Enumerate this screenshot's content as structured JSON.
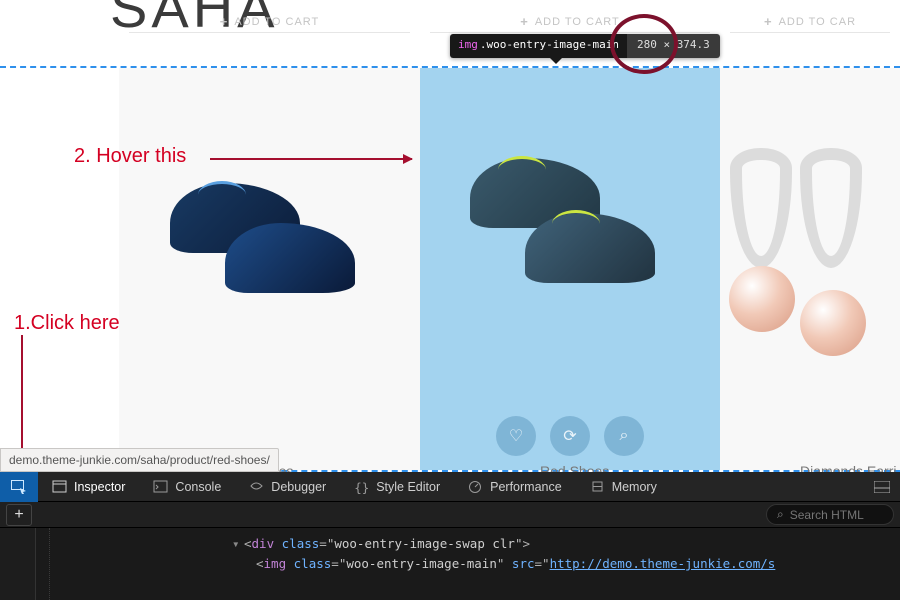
{
  "logo": "SAHA",
  "cards": {
    "c1": {
      "add": "ADD TO CART"
    },
    "c2": {
      "add": "ADD TO CART"
    },
    "c3": {
      "add": "ADD TO CAR"
    }
  },
  "productNames": {
    "p1": "hoes",
    "p2": "Red Shoes",
    "p3": "Diamonds Earri"
  },
  "tooltip": {
    "tag": "img",
    "cls": ".woo-entry-image-main",
    "dim": "280 × 374.3"
  },
  "annotations": {
    "hover": "2. Hover this",
    "click": "1.Click here"
  },
  "urlPreview": "demo.theme-junkie.com/saha/product/red-shoes/",
  "devtools": {
    "tabs": {
      "inspector": "Inspector",
      "console": "Console",
      "debugger": "Debugger",
      "style": "Style Editor",
      "performance": "Performance",
      "memory": "Memory"
    },
    "searchPlaceholder": "Search HTML",
    "code": {
      "divOpen": {
        "tag": "div",
        "classAttr": "class",
        "classVal": "woo-entry-image-swap clr"
      },
      "imgOpen": {
        "tag": "img",
        "classAttr": "class",
        "classVal": "woo-entry-image-main",
        "srcAttr": "src",
        "srcVal": "http://demo.theme-junkie.com/s"
      }
    }
  }
}
